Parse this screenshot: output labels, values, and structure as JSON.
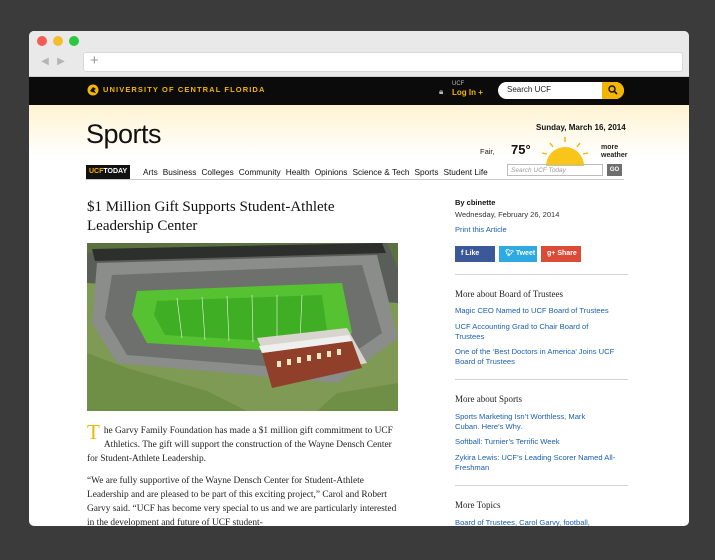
{
  "browser": {
    "back_icon": "chevron-left-icon",
    "forward_icon": "chevron-right-icon",
    "new_tab_icon": "plus-icon"
  },
  "topbar": {
    "logo_text": "UNIVERSITY OF CENTRAL FLORIDA",
    "login_small": "UCF",
    "login_label": "Log In +",
    "search_placeholder": "Search UCF"
  },
  "header": {
    "section_title": "Sports",
    "date": "Sunday, March 16, 2014",
    "weather_condition": "Fair,",
    "temperature": "75°",
    "more_weather_line1": "more",
    "more_weather_line2": "weather"
  },
  "nav": {
    "brand_left": "UCF",
    "brand_right": "TODAY",
    "items": [
      "Arts",
      "Business",
      "Colleges",
      "Community",
      "Health",
      "Opinions",
      "Science & Tech",
      "Sports",
      "Student Life"
    ],
    "search_placeholder": "Search UCF Today",
    "go_label": "GO"
  },
  "article": {
    "headline": "$1 Million Gift Supports Student-Athlete Leadership Center",
    "dropcap": "T",
    "p1": "he Garvy Family Foundation has made a $1 million gift commitment to UCF Athletics. The gift will support the construction of the Wayne Densch Center for Student-Athlete Leadership.",
    "p2": "“We are fully supportive of the Wayne Densch Center for Student-Athlete Leadership and are pleased to be part of this exciting project,” Carol and Robert Garvy said. “UCF has become very special to us and we are particularly interested in the development and future of UCF student-"
  },
  "sidebar": {
    "byline": "By cbinette",
    "date": "Wednesday, February 26, 2014",
    "print": "Print this Article",
    "share": {
      "facebook": "Like",
      "twitter": "Tweet",
      "google": "Share"
    },
    "section1_title": "More about Board of Trustees",
    "section1_links": [
      "Magic CEO Named to UCF Board of Trustees",
      "UCF Accounting Grad to Chair Board of Trustees",
      "One of the ‘Best Doctors in America’ Joins UCF Board of Trustees"
    ],
    "section2_title": "More about Sports",
    "section2_links": [
      "Sports Marketing Isn’t Worthless, Mark Cuban. Here’s Why.",
      "Softball: Turnier’s Terrific Week",
      "Zykira Lewis: UCF’s Leading Scorer Named All-Freshman"
    ],
    "section3_title": "More Topics",
    "section3_text": "Board of Trustees, Carol Garvy, football,"
  },
  "colors": {
    "accent": "#f2b600",
    "link": "#1a5fb0",
    "topbar": "#0b0b0b"
  }
}
